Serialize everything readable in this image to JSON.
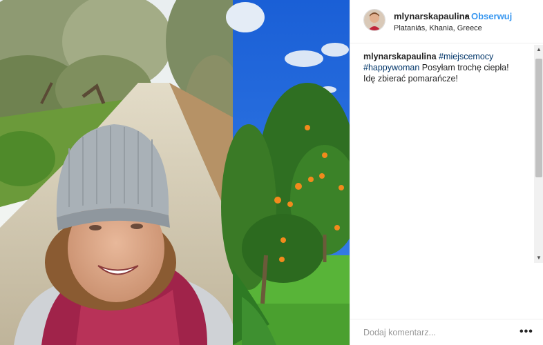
{
  "post": {
    "username": "mlynarskapaulina",
    "separator": "•",
    "follow_label": "Obserwuj",
    "location": "Plataniás, Khania, Greece"
  },
  "caption": {
    "username": "mlynarskapaulina",
    "hashtag1": "#miejscemocy",
    "hashtag2": "#happywoman",
    "text1": "Posyłam trochę ciepła!",
    "text2": "Idę zbierać pomarańcze!"
  },
  "comment": {
    "placeholder": "Dodaj komentarz...",
    "more_label": "•••"
  },
  "scrollbar": {
    "up_arrow": "▲",
    "down_arrow": "▼"
  },
  "colors": {
    "link": "#3897f0",
    "hashtag": "#003569",
    "text": "#262626",
    "placeholder": "#999999"
  }
}
